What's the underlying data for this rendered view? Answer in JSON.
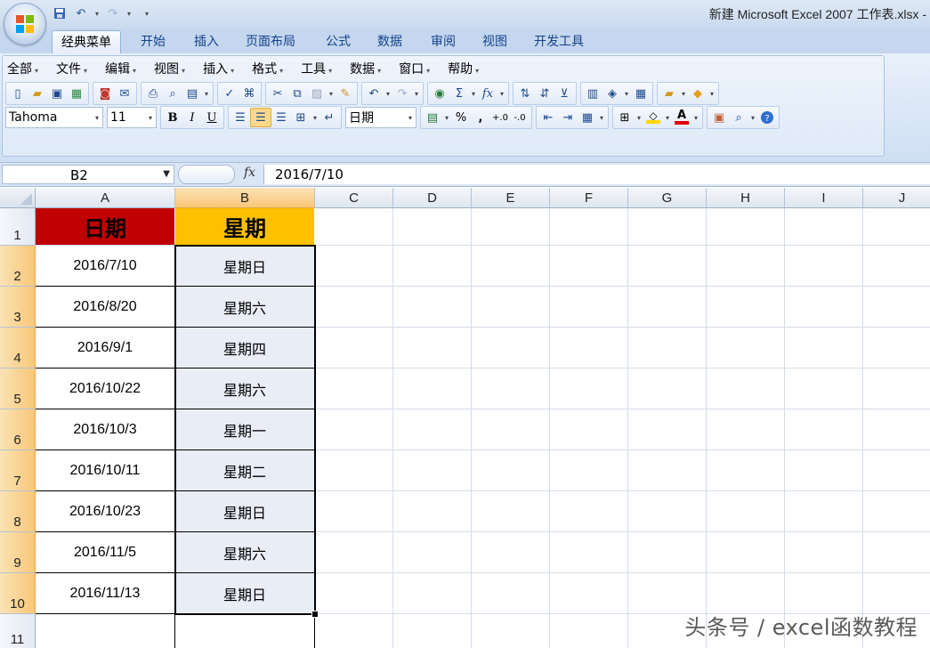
{
  "window": {
    "title": "新建 Microsoft Excel 2007 工作表.xlsx -"
  },
  "ribbon": {
    "tabs": [
      "经典菜单",
      "开始",
      "插入",
      "页面布局",
      "公式",
      "数据",
      "审阅",
      "视图",
      "开发工具"
    ],
    "active_tab": "经典菜单",
    "menus": [
      "全部",
      "文件",
      "编辑",
      "视图",
      "插入",
      "格式",
      "工具",
      "数据",
      "窗口",
      "帮助"
    ],
    "font_name": "Tahoma",
    "font_size": "11",
    "number_format": "日期",
    "bold_label": "B",
    "italic_label": "I",
    "underline_label": "U",
    "percent_label": "%",
    "comma_label": ",",
    "sum_label": "Σ",
    "fx_label": "fx",
    "font_color_label": "A",
    "fill_color": "#ffd700",
    "font_color": "#e00000"
  },
  "formula_bar": {
    "name_box": "B2",
    "fx_label": "fx",
    "formula": "2016/7/10"
  },
  "sheet": {
    "columns": [
      "A",
      "B",
      "C",
      "D",
      "E",
      "F",
      "G",
      "H",
      "I",
      "J"
    ],
    "rows": [
      "1",
      "2",
      "3",
      "4",
      "5",
      "6",
      "7",
      "8",
      "9",
      "10",
      "11"
    ],
    "header": {
      "a1": "日期",
      "b1": "星期",
      "a1_bg": "#c00000",
      "b1_bg": "#ffc000"
    },
    "data": [
      {
        "date": "2016/7/10",
        "weekday": "星期日"
      },
      {
        "date": "2016/8/20",
        "weekday": "星期六"
      },
      {
        "date": "2016/9/1",
        "weekday": "星期四"
      },
      {
        "date": "2016/10/22",
        "weekday": "星期六"
      },
      {
        "date": "2016/10/3",
        "weekday": "星期一"
      },
      {
        "date": "2016/10/11",
        "weekday": "星期二"
      },
      {
        "date": "2016/10/23",
        "weekday": "星期日"
      },
      {
        "date": "2016/11/5",
        "weekday": "星期六"
      },
      {
        "date": "2016/11/13",
        "weekday": "星期日"
      }
    ],
    "selected_cell": "B2"
  },
  "watermark": "头条号 / excel函数教程"
}
